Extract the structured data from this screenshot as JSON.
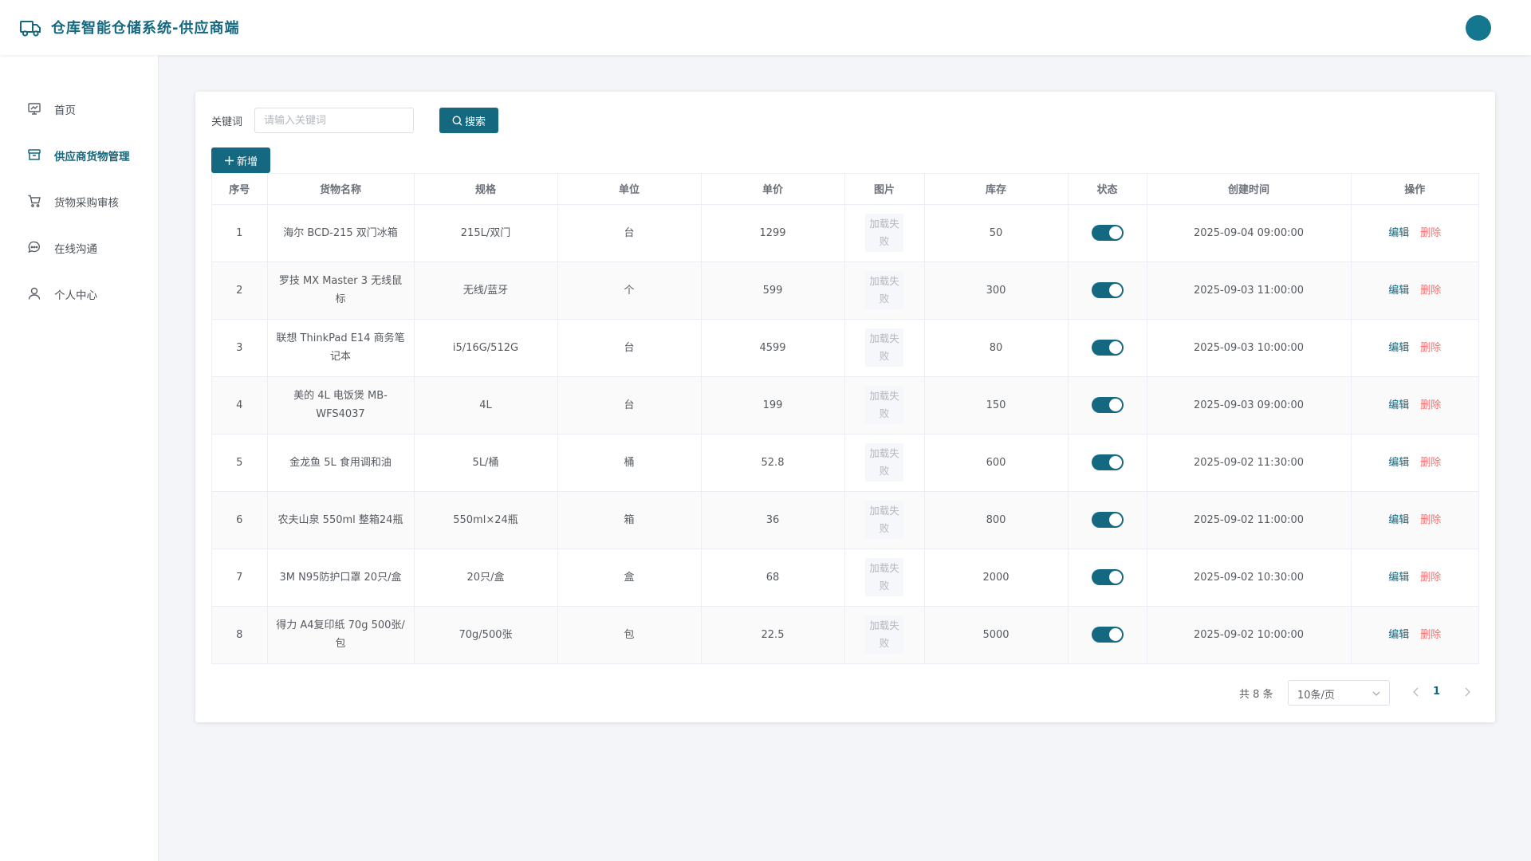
{
  "header": {
    "title": "仓库智能仓储系统-供应商端"
  },
  "sidebar": {
    "items": [
      {
        "label": "首页",
        "icon": "dashboard-icon"
      },
      {
        "label": "供应商货物管理",
        "icon": "box-icon",
        "active": true
      },
      {
        "label": "货物采购审核",
        "icon": "cart-icon"
      },
      {
        "label": "在线沟通",
        "icon": "chat-icon"
      },
      {
        "label": "个人中心",
        "icon": "user-icon"
      }
    ]
  },
  "search": {
    "label": "关键词",
    "placeholder": "请输入关键词",
    "button": "搜索"
  },
  "toolbar": {
    "add_label": "新增"
  },
  "table": {
    "columns": [
      "序号",
      "货物名称",
      "规格",
      "单位",
      "单价",
      "图片",
      "库存",
      "状态",
      "创建时间",
      "操作"
    ],
    "image_failed_text": "加载失败",
    "edit_label": "编辑",
    "delete_label": "删除",
    "rows": [
      {
        "index": "1",
        "name": "海尔 BCD-215 双门冰箱",
        "spec": "215L/双门",
        "unit": "台",
        "price": "1299",
        "stock": "50",
        "enabled": true,
        "created": "2025-09-04 09:00:00"
      },
      {
        "index": "2",
        "name": "罗技 MX Master 3 无线鼠标",
        "spec": "无线/蓝牙",
        "unit": "个",
        "price": "599",
        "stock": "300",
        "enabled": true,
        "created": "2025-09-03 11:00:00"
      },
      {
        "index": "3",
        "name": "联想 ThinkPad E14 商务笔记本",
        "spec": "i5/16G/512G",
        "unit": "台",
        "price": "4599",
        "stock": "80",
        "enabled": true,
        "created": "2025-09-03 10:00:00"
      },
      {
        "index": "4",
        "name": "美的 4L 电饭煲 MB-WFS4037",
        "spec": "4L",
        "unit": "台",
        "price": "199",
        "stock": "150",
        "enabled": true,
        "created": "2025-09-03 09:00:00"
      },
      {
        "index": "5",
        "name": "金龙鱼 5L 食用调和油",
        "spec": "5L/桶",
        "unit": "桶",
        "price": "52.8",
        "stock": "600",
        "enabled": true,
        "created": "2025-09-02 11:30:00"
      },
      {
        "index": "6",
        "name": "农夫山泉 550ml 整箱24瓶",
        "spec": "550ml×24瓶",
        "unit": "箱",
        "price": "36",
        "stock": "800",
        "enabled": true,
        "created": "2025-09-02 11:00:00"
      },
      {
        "index": "7",
        "name": "3M N95防护口罩 20只/盒",
        "spec": "20只/盒",
        "unit": "盒",
        "price": "68",
        "stock": "2000",
        "enabled": true,
        "created": "2025-09-02 10:30:00"
      },
      {
        "index": "8",
        "name": "得力 A4复印纸 70g 500张/包",
        "spec": "70g/500张",
        "unit": "包",
        "price": "22.5",
        "stock": "5000",
        "enabled": true,
        "created": "2025-09-02 10:00:00"
      }
    ]
  },
  "pagination": {
    "total_text": "共 8 条",
    "page_size": "10条/页",
    "current_page": "1"
  },
  "colors": {
    "primary": "#14687f",
    "danger": "#f56c6c",
    "avatar": "#14768f"
  }
}
